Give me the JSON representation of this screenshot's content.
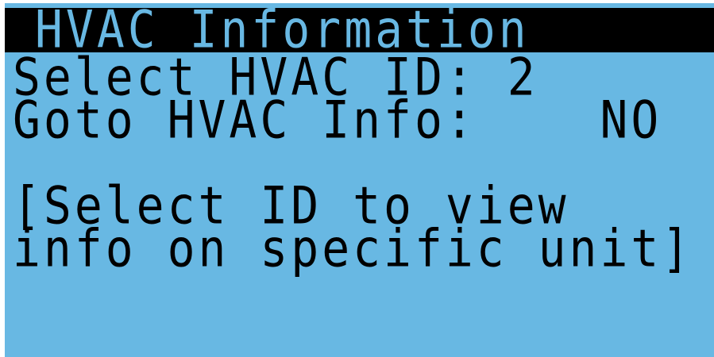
{
  "screen": {
    "title": "HVAC Information",
    "select_id_label": "Select HVAC ID:",
    "select_id_value": "2",
    "goto_label": "Goto HVAC Info:",
    "goto_value": "NO",
    "help_line1": "[Select ID to view",
    "help_line2": "info on specific unit]"
  },
  "colors": {
    "background": "#68b8e3",
    "foreground": "#000000",
    "title_bar": "#000000"
  }
}
